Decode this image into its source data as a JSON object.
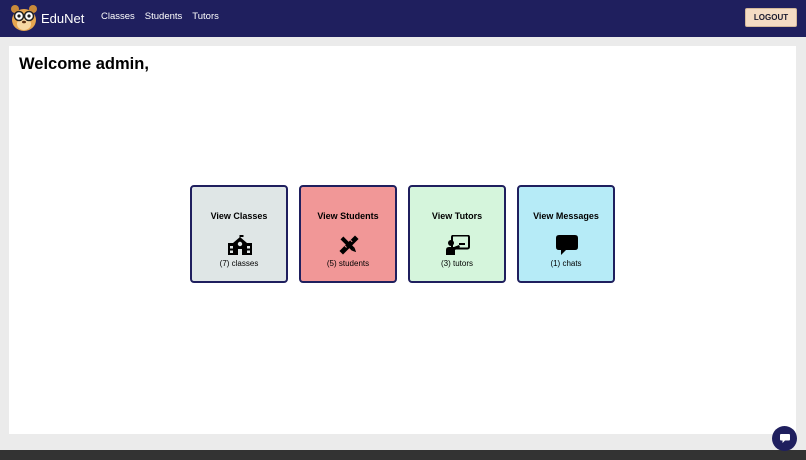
{
  "app": {
    "name": "EduNet"
  },
  "nav": {
    "items": [
      {
        "label": "Classes"
      },
      {
        "label": "Students"
      },
      {
        "label": "Tutors"
      }
    ]
  },
  "header": {
    "logout_label": "LOGOUT"
  },
  "main": {
    "welcome": "Welcome admin,"
  },
  "cards": [
    {
      "title": "View Classes",
      "count": "(7) classes",
      "icon": "school-icon",
      "color": "#dfe6e6"
    },
    {
      "title": "View Students",
      "count": "(5) students",
      "icon": "pencil-ruler-icon",
      "color": "#f19797"
    },
    {
      "title": "View Tutors",
      "count": "(3) tutors",
      "icon": "teacher-icon",
      "color": "#d5f5dc"
    },
    {
      "title": "View Messages",
      "count": "(1) chats",
      "icon": "chat-bubble-icon",
      "color": "#b6ebf7"
    }
  ],
  "colors": {
    "navbar": "#1f1f5e",
    "logout_button": "#f4dcc4",
    "background": "#ebebeb"
  },
  "icons": {
    "logo": "owl-logo",
    "chat_fab": "chat-icon"
  }
}
